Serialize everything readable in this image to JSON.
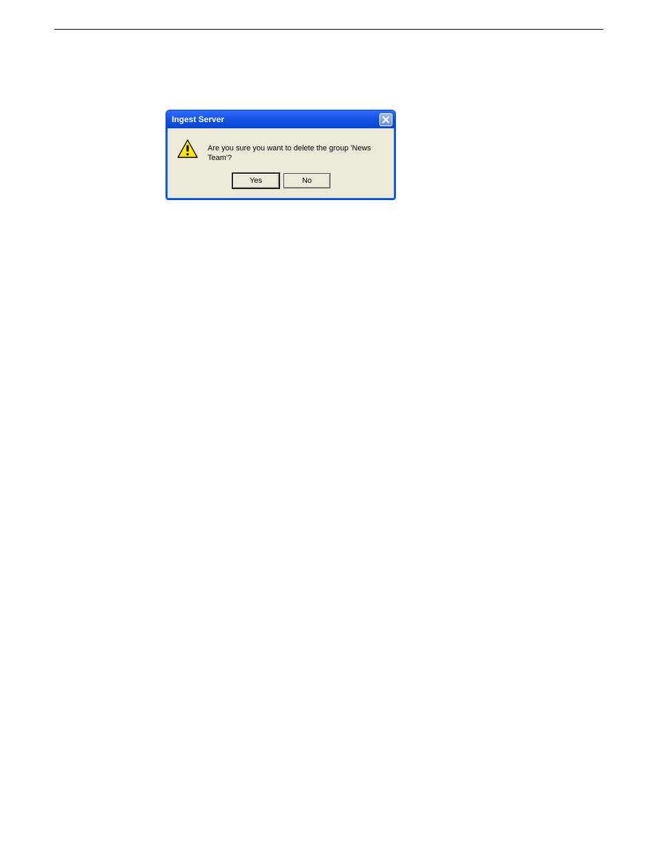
{
  "dialog": {
    "title": "Ingest Server",
    "message": "Are you sure you want to delete the group 'News Team'?",
    "buttons": {
      "yes_label": "Yes",
      "no_label": "No"
    }
  }
}
